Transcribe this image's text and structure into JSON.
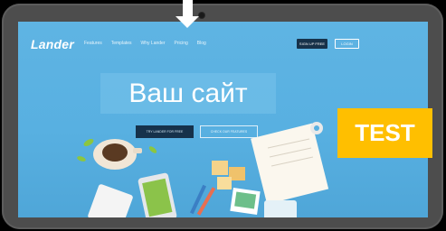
{
  "site": {
    "logo": "Lander",
    "nav": [
      "Features",
      "Templates",
      "Why Lander",
      "Pricing",
      "Blog"
    ],
    "signup_label": "SIGN UP FREE",
    "login_label": "LOGIN",
    "hero_text": "Ваш сайт",
    "cta_primary": "TRY LANDER FOR FREE",
    "cta_secondary": "CHECK OUR FEATURES"
  },
  "overlay": {
    "badge_text": "TEST"
  },
  "colors": {
    "background": "#000000",
    "tablet_frame": "#4d4d4d",
    "screen": "#5fb4e3",
    "badge": "#ffbf00",
    "button_dark": "#16324b"
  },
  "icons": [
    "down-arrow-icon",
    "camera-icon"
  ]
}
